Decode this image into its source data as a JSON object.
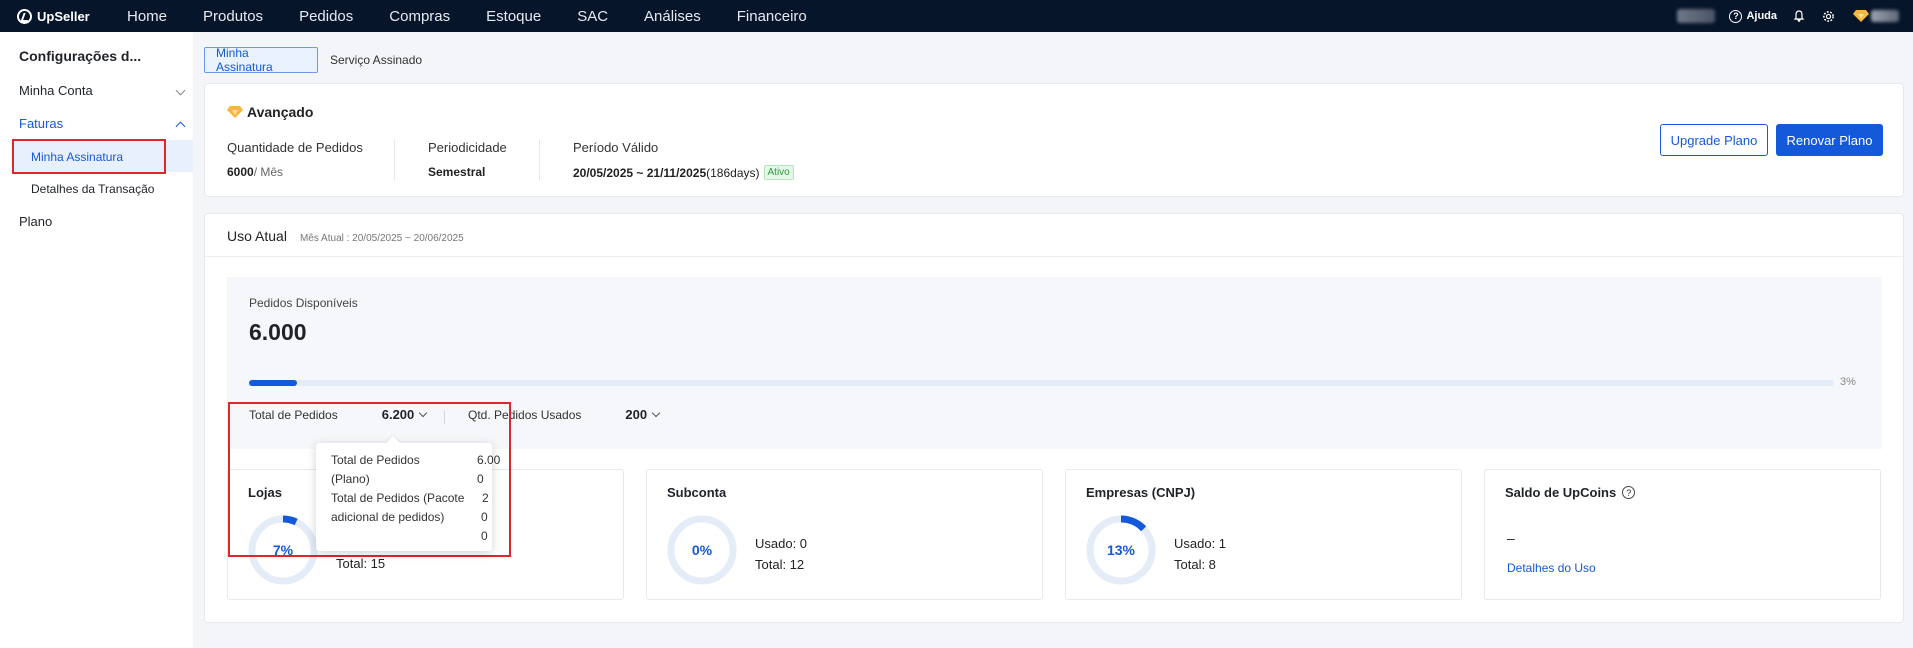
{
  "topnav": {
    "brand": "UpSeller",
    "items": [
      "Home",
      "Produtos",
      "Pedidos",
      "Compras",
      "Estoque",
      "SAC",
      "Análises",
      "Financeiro"
    ],
    "help": "Ajuda"
  },
  "sidebar": {
    "title": "Configurações d...",
    "minha_conta": "Minha Conta",
    "faturas": "Faturas",
    "minha_assinatura": "Minha Assinatura",
    "detalhes_transacao": "Detalhes da Transação",
    "plano": "Plano"
  },
  "tabs": {
    "active": "Minha Assinatura",
    "other": "Serviço Assinado"
  },
  "plan": {
    "name": "Avançado",
    "qty_label": "Quantidade de Pedidos",
    "qty_value": "6000",
    "qty_unit": " / Mês",
    "period_label": "Periodicidade",
    "period_value": "Semestral",
    "valid_label": "Período Válido",
    "valid_value": "20/05/2025 ~ 21/11/2025",
    "valid_days": " (186days)",
    "status": "Ativo",
    "upgrade_btn": "Upgrade Plano",
    "renew_btn": "Renovar Plano"
  },
  "usage": {
    "title": "Uso Atual",
    "month": "Mês Atual : 20/05/2025 ~ 20/06/2025",
    "available_label": "Pedidos Disponíveis",
    "available_value": "6.000",
    "progress_percent": 3,
    "progress_label": "3%",
    "total_label": "Total de Pedidos",
    "total_value": "6.200",
    "used_label": "Qtd. Pedidos Usados",
    "used_value": "200"
  },
  "popover": {
    "row1_label": "Total de Pedidos",
    "row1_label2": "(Plano)",
    "row1_v1": "6.00",
    "row1_v2": "0",
    "row2_label": "Total de Pedidos (Pacote",
    "row2_label2": "adicional de pedidos)",
    "row2_v1": "2",
    "row2_v2": "0",
    "row2_v3": "0"
  },
  "stats": {
    "lojas": {
      "title": "Lojas",
      "pct": "7%",
      "pct_value": 7,
      "total": "Total: 15"
    },
    "subconta": {
      "title": "Subconta",
      "pct": "0%",
      "pct_value": 0,
      "used": "Usado: 0",
      "total": "Total: 12"
    },
    "empresas": {
      "title": "Empresas (CNPJ)",
      "pct": "13%",
      "pct_value": 13,
      "used": "Usado: 1",
      "total": "Total: 8"
    },
    "upcoins": {
      "title": "Saldo de UpCoins",
      "value": "–",
      "link": "Detalhes do Uso"
    }
  },
  "colors": {
    "accent": "#1459d9",
    "nav_bg": "#07152b",
    "highlight": "#e0252b",
    "active_green": "#2a9d3d"
  }
}
